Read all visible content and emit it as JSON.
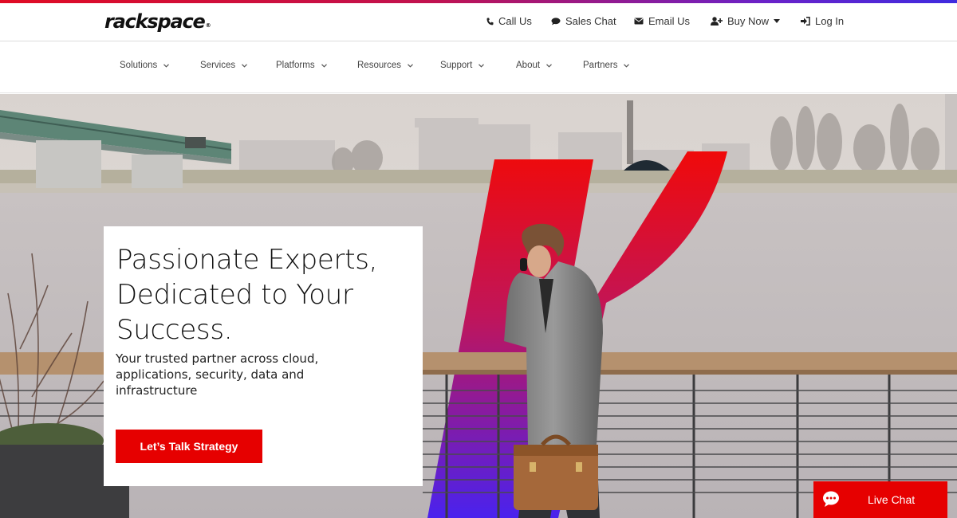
{
  "brand": {
    "logo_text": "rackspace",
    "reg_mark": "®"
  },
  "utility_nav": [
    {
      "label": "Call Us",
      "icon": "phone-icon"
    },
    {
      "label": "Sales Chat",
      "icon": "chat-icon"
    },
    {
      "label": "Email Us",
      "icon": "envelope-icon"
    },
    {
      "label": "Buy Now",
      "icon": "user-plus-icon",
      "dropdown": true
    },
    {
      "label": "Log In",
      "icon": "sign-in-icon"
    }
  ],
  "main_nav": [
    {
      "label": "Solutions"
    },
    {
      "label": "Services"
    },
    {
      "label": "Platforms"
    },
    {
      "label": "Resources"
    },
    {
      "label": "Support"
    },
    {
      "label": "About"
    },
    {
      "label": "Partners"
    }
  ],
  "hero": {
    "headline_line1": "Passionate Experts,",
    "headline_line2": "Dedicated to Your",
    "headline_line3": "Success.",
    "subline_line1": "Your trusted partner across cloud,",
    "subline_line2": "applications, security, data and",
    "subline_line3": "infrastructure",
    "cta_label": "Let’s Talk Strategy"
  },
  "live_chat": {
    "label": "Live Chat",
    "icon": "chat-bubble-icon"
  },
  "colors": {
    "brand_red": "#e60000",
    "stripe_start": "#e00b24",
    "stripe_end": "#3f2bdf"
  }
}
